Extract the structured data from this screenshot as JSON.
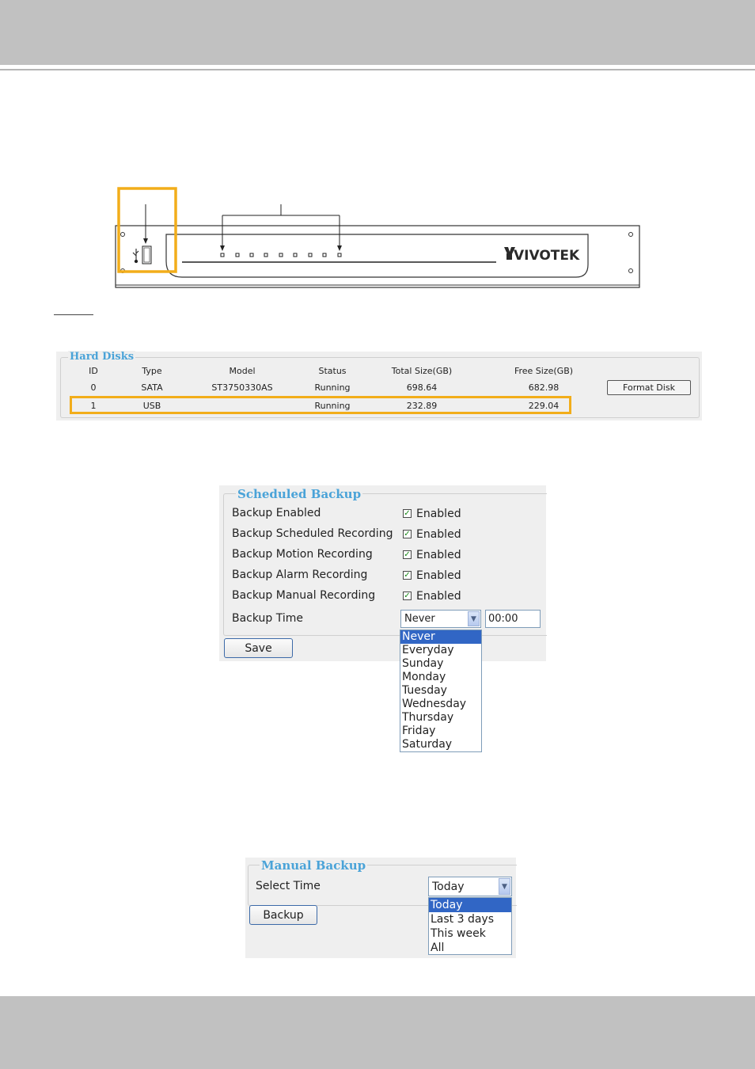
{
  "device": {
    "brand_logo": "VIVOTEK"
  },
  "hard_disks": {
    "legend": "Hard Disks",
    "columns": [
      "ID",
      "Type",
      "Model",
      "Status",
      "Total Size(GB)",
      "Free Size(GB)"
    ],
    "rows": [
      [
        "0",
        "SATA",
        "ST3750330AS",
        "Running",
        "698.64",
        "682.98"
      ],
      [
        "1",
        "USB",
        "",
        "Running",
        "232.89",
        "229.04"
      ]
    ],
    "format_label": "Format Disk"
  },
  "scheduled_backup": {
    "legend": "Scheduled Backup",
    "rows": [
      {
        "label": "Backup Enabled",
        "checkbox": "Enabled"
      },
      {
        "label": "Backup Scheduled Recording",
        "checkbox": "Enabled"
      },
      {
        "label": "Backup Motion Recording",
        "checkbox": "Enabled"
      },
      {
        "label": "Backup Alarm Recording",
        "checkbox": "Enabled"
      },
      {
        "label": "Backup Manual Recording",
        "checkbox": "Enabled"
      }
    ],
    "time_label": "Backup Time",
    "time_select": "Never",
    "time_value": "00:00",
    "time_options": [
      "Never",
      "Everyday",
      "Sunday",
      "Monday",
      "Tuesday",
      "Wednesday",
      "Thursday",
      "Friday",
      "Saturday"
    ],
    "save_label": "Save"
  },
  "manual_backup": {
    "legend": "Manual Backup",
    "select_label": "Select Time",
    "select_value": "Today",
    "options": [
      "Today",
      "Last 3 days",
      "This week",
      "All"
    ],
    "backup_label": "Backup"
  },
  "colors": {
    "legend": "#4aa3d8",
    "highlight": "#f2ad1a",
    "selected_option": "#3166c5",
    "band": "#c1c1c1"
  }
}
